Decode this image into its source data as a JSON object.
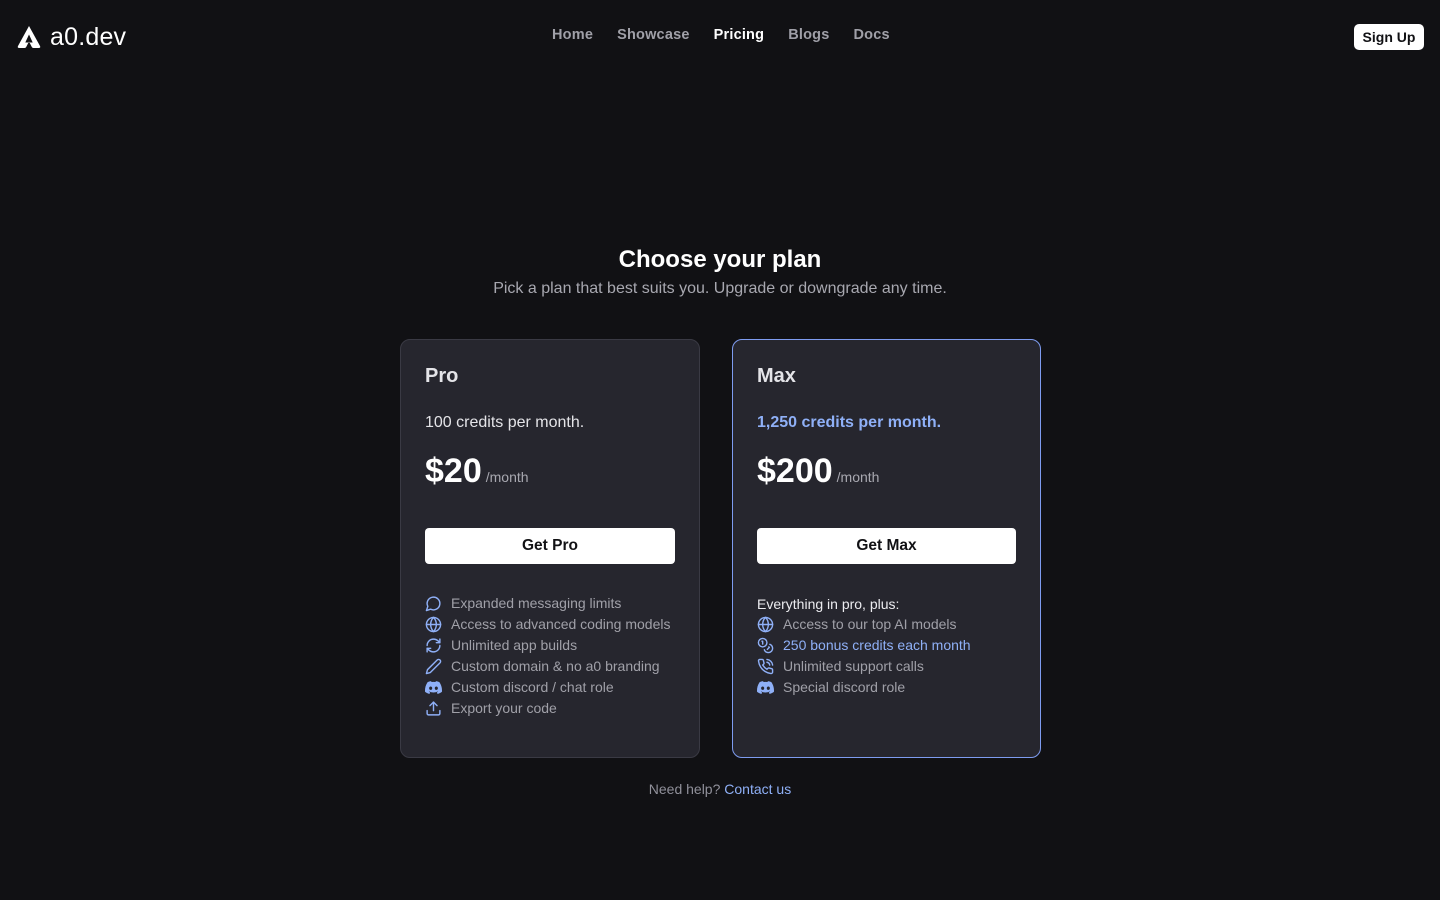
{
  "brand": {
    "name": "a0.dev"
  },
  "nav": {
    "links": [
      "Home",
      "Showcase",
      "Pricing",
      "Blogs",
      "Docs"
    ],
    "active": "Pricing",
    "signup_label": "Sign Up"
  },
  "hero": {
    "title": "Choose your plan",
    "subtitle": "Pick a plan that best suits you. Upgrade or downgrade any time."
  },
  "plans": [
    {
      "name": "Pro",
      "credits": "100 credits per month.",
      "price": "$20",
      "unit": "/month",
      "cta": "Get Pro",
      "features": [
        {
          "icon": "chat-bubble-icon",
          "text": "Expanded messaging limits"
        },
        {
          "icon": "globe-icon",
          "text": "Access to advanced coding models"
        },
        {
          "icon": "refresh-icon",
          "text": "Unlimited app builds"
        },
        {
          "icon": "pencil-icon",
          "text": "Custom domain & no a0 branding"
        },
        {
          "icon": "discord-icon",
          "text": "Custom discord / chat role"
        },
        {
          "icon": "upload-icon",
          "text": "Export your code"
        }
      ]
    },
    {
      "name": "Max",
      "credits": "1,250 credits per month.",
      "price": "$200",
      "unit": "/month",
      "cta": "Get Max",
      "features_heading": "Everything in pro, plus:",
      "features": [
        {
          "icon": "globe-icon",
          "text": "Access to our top AI models"
        },
        {
          "icon": "coins-icon",
          "text": "250 bonus credits each month",
          "highlight": true
        },
        {
          "icon": "phone-icon",
          "text": "Unlimited support calls"
        },
        {
          "icon": "discord-icon",
          "text": "Special discord role"
        }
      ]
    }
  ],
  "help": {
    "text": "Need help?",
    "link": "Contact us"
  },
  "colors": {
    "background": "#111114",
    "card": "#26262e",
    "accent": "#8fb0f7",
    "highlight_border": "#7e9cf0"
  }
}
